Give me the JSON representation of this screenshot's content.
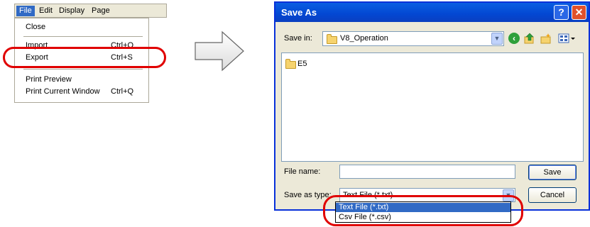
{
  "menu": {
    "bar": [
      "File",
      "Edit",
      "Display",
      "Page"
    ],
    "items": [
      {
        "label": "Close",
        "shortcut": ""
      },
      {
        "label": "Import",
        "shortcut": "Ctrl+O"
      },
      {
        "label": "Export",
        "shortcut": "Ctrl+S"
      },
      {
        "label": "Print Preview",
        "shortcut": ""
      },
      {
        "label": "Print Current Window",
        "shortcut": "Ctrl+Q"
      }
    ]
  },
  "dialog": {
    "title": "Save As",
    "help": "?",
    "close": "✕",
    "save_in_label": "Save in:",
    "save_in_value": "V8_Operation",
    "files": [
      "E5"
    ],
    "file_name_label": "File name:",
    "file_name_value": "",
    "save_type_label": "Save as type:",
    "save_type_value": "Text File (*.txt)",
    "save_button": "Save",
    "cancel_button": "Cancel",
    "type_options": [
      "Text File (*.txt)",
      "Csv File (*.csv)"
    ]
  },
  "colors": {
    "highlight": "#e00000",
    "selection": "#316ac5",
    "titlebar": "#0a5ee2"
  }
}
